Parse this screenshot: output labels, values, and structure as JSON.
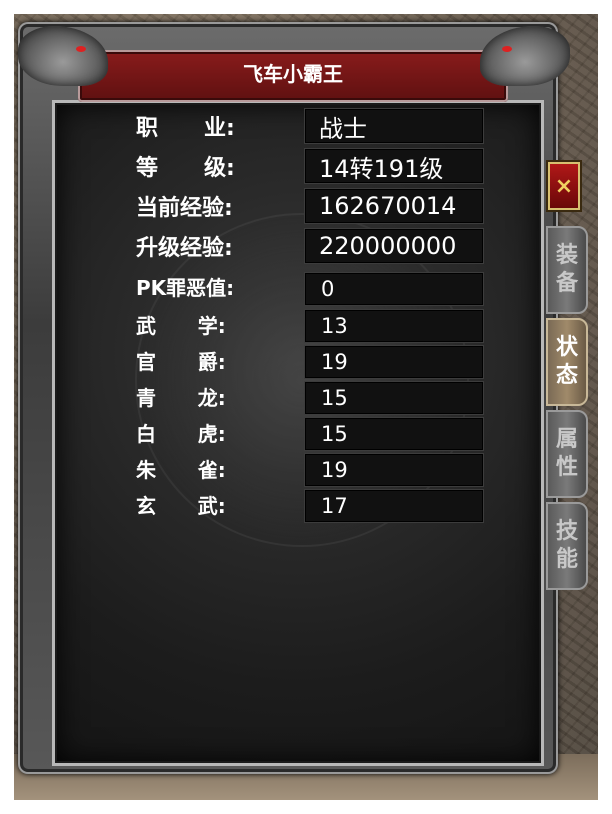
{
  "window": {
    "title": "飞车小霸王",
    "close_label": "×"
  },
  "stats": [
    {
      "label": "职      业:",
      "value": "战士"
    },
    {
      "label": "等      级:",
      "value": "14转191级"
    },
    {
      "label": "当前经验:",
      "value": "162670014"
    },
    {
      "label": "升级经验:",
      "value": "220000000"
    },
    {
      "label": "PK罪恶值:",
      "value": "0"
    },
    {
      "label": "武      学:",
      "value": "13"
    },
    {
      "label": "官      爵:",
      "value": "19"
    },
    {
      "label": "青      龙:",
      "value": "15"
    },
    {
      "label": "白      虎:",
      "value": "15"
    },
    {
      "label": "朱      雀:",
      "value": "19"
    },
    {
      "label": "玄      武:",
      "value": "17"
    }
  ],
  "tabs": [
    {
      "chars": [
        "装",
        "备"
      ],
      "active": false
    },
    {
      "chars": [
        "状",
        "态"
      ],
      "active": true
    },
    {
      "chars": [
        "属",
        "性"
      ],
      "active": false
    },
    {
      "chars": [
        "技",
        "能"
      ],
      "active": false
    }
  ],
  "colors": {
    "title_bar": "#8a1c1c",
    "close_button": "#b01818",
    "active_tab": "#a08a6a"
  }
}
